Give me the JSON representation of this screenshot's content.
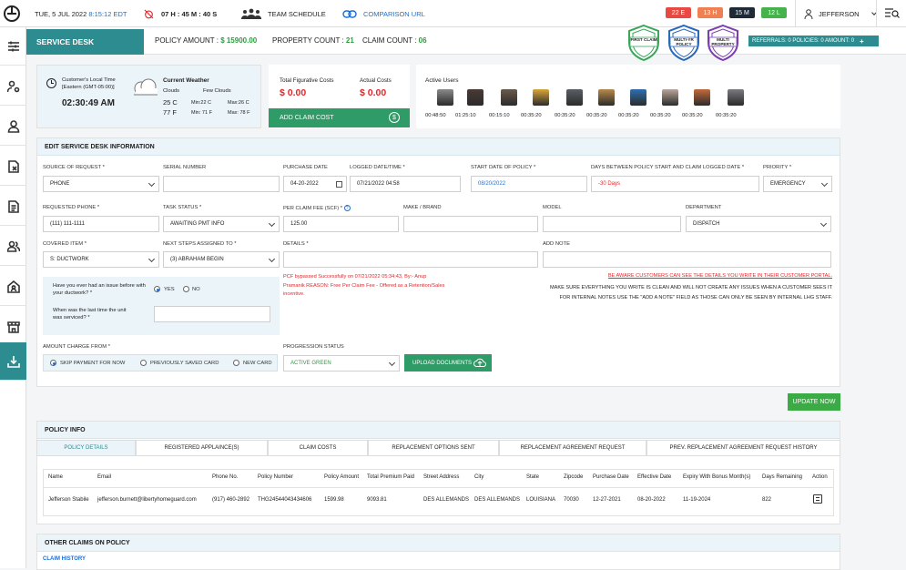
{
  "topbar": {
    "date": "TUE, 5 JUL 2022",
    "time": "8:15:12 EDT",
    "timer": "07 H : 45 M : 40 S",
    "team_schedule": "TEAM SCHEDULE",
    "comparison_url": "COMPARISON URL",
    "pills": [
      {
        "label": "22 E",
        "color": "#e84a43"
      },
      {
        "label": "13 H",
        "color": "#f07f52"
      },
      {
        "label": "15 M",
        "color": "#1e2a36"
      },
      {
        "label": "12 L",
        "color": "#45b24c"
      }
    ],
    "user": "JEFFERSON"
  },
  "header": {
    "tab": "SERVICE DESK",
    "policy_amount_label": "POLICY AMOUNT :",
    "policy_amount_value": "$ 15900.00",
    "property_count_label": "PROPERTY COUNT :",
    "property_count_value": "21",
    "claim_count_label": "CLAIM COUNT :",
    "claim_count_value": "06",
    "badges": [
      "FIRST CLAIM",
      "MULTI-YR POLICY",
      "MULTI PROPERTY"
    ],
    "referrals": "REFERRALS: 0   POLICIES: 0   AMOUNT: 0"
  },
  "local_time": {
    "label1": "Customer's Local Time",
    "label2": "[Eastern (GMT-05:00)]",
    "time": "02:30:49 AM"
  },
  "weather": {
    "title": "Current Weather",
    "cond1": "Clouds",
    "cond2": "Few Clouds",
    "temp_c": "25 C",
    "temp_f": "77 F",
    "min_c": "Min:22 C",
    "min_f": "Min: 71 F",
    "max_c": "Max:26 C",
    "max_f": "Max: 78 F"
  },
  "costs": {
    "fig_label": "Total Figurative Costs",
    "fig_value": "$ 0.00",
    "act_label": "Actual Costs",
    "act_value": "$ 0.00",
    "add_claim": "ADD CLAIM COST"
  },
  "active_users": {
    "title": "Active Users",
    "times": [
      "00:48:50",
      "01:25:10",
      "00:15:10",
      "00:35:20",
      "00:35:20",
      "00:35:20",
      "00:35:20",
      "00:35:20",
      "00:35:20",
      "00:35:20"
    ],
    "colors": [
      "#8a8a8a",
      "#4a3a35",
      "#6b5a4a",
      "#d9a63a",
      "#5a5f66",
      "#b78a4a",
      "#2f6fb0",
      "#b9a79a",
      "#c46a3a",
      "#7a7a80"
    ]
  },
  "form": {
    "title": "EDIT SERVICE DESK INFORMATION",
    "source_label": "SOURCE OF REQUEST *",
    "source_value": "PHONE",
    "serial_label": "SERIAL NUMBER",
    "serial_value": "",
    "purchase_label": "PURCHASE DATE",
    "purchase_value": "04-20-2022",
    "logged_label": "LOGGED DATE/TIME *",
    "logged_value": "07/21/2022 04:58",
    "start_label": "START DATE OF POLICY *",
    "start_value": "08/20/2022",
    "days_label": "DAYS BETWEEN POLICY START AND CLAIM LOGGED DATE *",
    "days_value": "-30 Days",
    "priority_label": "PRIORITY  *",
    "priority_value": "EMERGENCY",
    "phone_label": "REQUESTED PHONE *",
    "phone_value": "(111) 111-1111",
    "task_label": "TASK STATUS *",
    "task_value": "AWAITING PMT INFO",
    "fee_label": "PER CLAIM FEE (SCF) *",
    "fee_value": "125.00",
    "make_label": "MAKE / BRAND",
    "model_label": "MODEL",
    "dept_label": "DEPARTMENT",
    "dept_value": "DISPATCH",
    "covered_label": "COVERED ITEM *",
    "covered_value": "S: DUCTWORK",
    "next_label": "NEXT STEPS ASSIGNED TO *",
    "next_value": "(3) ABRAHAM BEGIN",
    "details_label": "DETAILS *",
    "note_label": "ADD NOTE",
    "q1": "Have you ever had an issue before with your ductwork? *",
    "yes": "YES",
    "no": "NO",
    "q2": "When was the last time the unit was serviced? *",
    "pcf_note": "PCF bypassed Successfully on 07/21/2022 05:34:43, By:- Anup Pramanik REASON: Free Per Claim Fee - Offered as a Retention/Sales incentive.",
    "warn1": "BE AWARE CUSTOMERS CAN SEE THE DETAILS YOU WRITE IN THEIR CUSTOMER PORTAL.",
    "warn2": "MAKE SURE EVERYTHING YOU WRITE IS CLEAN AND WILL NOT CREATE ANY ISSUES WHEN A CUSTOMER SEES IT FOR INTERNAL NOTES USE THE \"ADD A NOTE\" FIELD AS THOSE CAN ONLY BE SEEN BY INTERNAL LHG STAFF.",
    "charge_label": "AMOUNT CHARGE FROM *",
    "charge_opts": [
      "SKIP PAYMENT FOR NOW",
      "PREVIOUSLY SAVED CARD",
      "NEW CARD"
    ],
    "progress_label": "PROGRESSION STATUS",
    "progress_value": "ACTIVE GREEN",
    "upload": "UPLOAD DOCUMENTS",
    "update": "UPDATE NOW"
  },
  "policy": {
    "title": "POLICY INFO",
    "tabs": [
      "POLICY DETAILS",
      "REGISTERED APPLAINCE(S)",
      "CLAIM COSTS",
      "REPLACEMENT OPTIONS SENT",
      "REPLACEMENT AGREEMENT REQUEST",
      "PREV. REPLACEMENT AGREEMENT REQUEST HISTORY"
    ],
    "headers": [
      "Name",
      "Email",
      "Phone No.",
      "Policy Number",
      "Policy Amount",
      "Total Premium Paid",
      "Street Address",
      "City",
      "State",
      "Zipcode",
      "Purchase Date",
      "Effective Date",
      "Expiry With Bonus Month(s)",
      "Days Remaining",
      "Action"
    ],
    "row": [
      "Jefferson Stabile",
      "jefferson.burnett@libertyhomeguard.com",
      "(917) 460-2892",
      "THG24544043434606",
      "1599.98",
      "9093.81",
      "DES ALLEMANDS",
      "DES ALLEMANDS",
      "LOUISIANA",
      "70030",
      "12-27-2021",
      "08-20-2022",
      "11-19-2024",
      "822"
    ]
  },
  "other_claims": {
    "title": "OTHER CLAIMS ON POLICY",
    "history": "CLAIM HISTORY"
  }
}
